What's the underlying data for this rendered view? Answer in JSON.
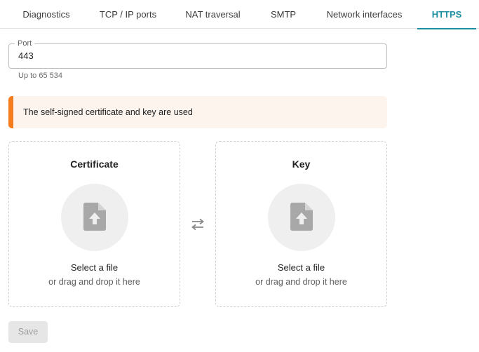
{
  "tabs": [
    {
      "label": "Diagnostics",
      "active": false
    },
    {
      "label": "TCP / IP ports",
      "active": false
    },
    {
      "label": "NAT traversal",
      "active": false
    },
    {
      "label": "SMTP",
      "active": false
    },
    {
      "label": "Network interfaces",
      "active": false
    },
    {
      "label": "HTTPS",
      "active": true
    }
  ],
  "port": {
    "label": "Port",
    "value": "443",
    "hint": "Up to 65 534"
  },
  "alert": {
    "text": "The self-signed certificate and key are used"
  },
  "certificate": {
    "title": "Certificate",
    "select_label": "Select a file",
    "drop_hint": "or drag and drop it here"
  },
  "key": {
    "title": "Key",
    "select_label": "Select a file",
    "drop_hint": "or drag and drop it here"
  },
  "save_label": "Save",
  "colors": {
    "accent": "#1e8fa0",
    "warning": "#f57c1f",
    "alert_bg": "#fdf4ee"
  },
  "icons": {
    "upload": "file-upload-icon",
    "swap": "swap-arrows-icon"
  }
}
